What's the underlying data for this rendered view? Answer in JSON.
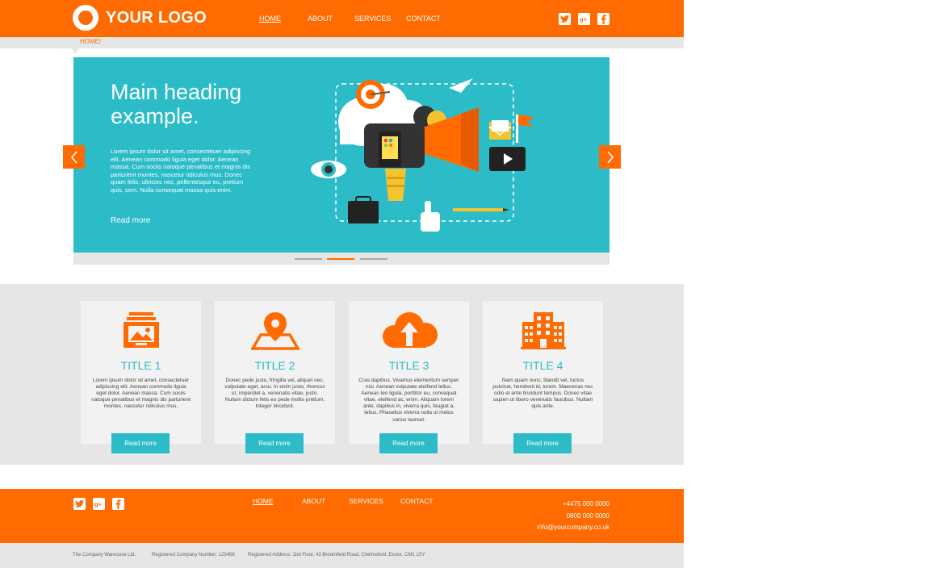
{
  "header": {
    "logo_text": "YOUR LOGO",
    "nav": [
      "HOME",
      "ABOUT",
      "SERVICES",
      "CONTACT"
    ],
    "active_nav": "HOME",
    "social": [
      "twitter-icon",
      "google-plus-icon",
      "facebook-icon"
    ]
  },
  "breadcrumb": {
    "label": "HOME",
    "separator": "/"
  },
  "hero": {
    "heading": "Main heading example.",
    "body": "Lorem ipsum dolor sit amet, consectetuer adipiscing elit. Aenean commodo ligula eget dolor. Aenean massa. Cum sociis natoque penatibus et magnis dis parturient montes, nascetur ridiculus mus. Donec quam felis, ultricies nec, pellentesque eu, pretium quis, sem. Nulla consequat massa quis enim.",
    "read_more": "Read more",
    "slide_count": 3,
    "active_slide": 2
  },
  "features": [
    {
      "icon": "picture-folder-icon",
      "title": "TITLE 1",
      "text": "Lorem ipsum dolor sit amet, consectetuer adipiscing elit. Aenean commodo ligula eget dolor. Aenean massa. Cum sociis natoque penatibus et magnis dis parturient montes, nascetur ridiculus mus.",
      "button": "Read more"
    },
    {
      "icon": "map-pin-icon",
      "title": "TITLE 2",
      "text": "Donec pede justo, fringilla vel, aliquet nec, vulputate eget, arcu. In enim justo, rhoncus ut, imperdiet a, venenatis vitae, justo. Nullam dictum felis eu pede mollis pretium. Integer tincidunt.",
      "button": "Read more"
    },
    {
      "icon": "cloud-upload-icon",
      "title": "TITLE 3",
      "text": "Cras dapibus. Vivamus elementum semper nisi. Aenean vulputate eleifend tellus. Aenean leo ligula, porttitor eu, consequat vitae, eleifend ac, enim. Aliquam lorem ante, dapibus in, viverra quis, feugiat a, tellus. Phasellus viverra nulla ut metus varius laoreet.",
      "button": "Read more"
    },
    {
      "icon": "office-building-icon",
      "title": "TITLE 4",
      "text": "Nam quam nunc, blandit vel, luctus pulvinar, hendrerit id, lorem. Maecenas nec odio et ante tincidunt tempus. Donec vitae sapien ut libero venenatis faucibus. Nullam quis ante.",
      "button": "Read more"
    }
  ],
  "footer": {
    "nav": [
      "HOME",
      "ABOUT",
      "SERVICES",
      "CONTACT"
    ],
    "phone1": "+4475 000 0000",
    "phone2": "0800 000 0000",
    "email": "info@yourcompany.co.uk"
  },
  "legal": {
    "company": "The Company Wareouse Ltd.",
    "reg_number": "Registered Company Number: 123456",
    "address": "Registered Address: 2nd Floor, 43 Broomfield Road, Chelmsford, Essex, CM1 1SY"
  },
  "colors": {
    "accent": "#ff6b00",
    "teal": "#2bbcc8",
    "light_gray": "#e6e6e6",
    "card_bg": "#f2f2f2"
  }
}
